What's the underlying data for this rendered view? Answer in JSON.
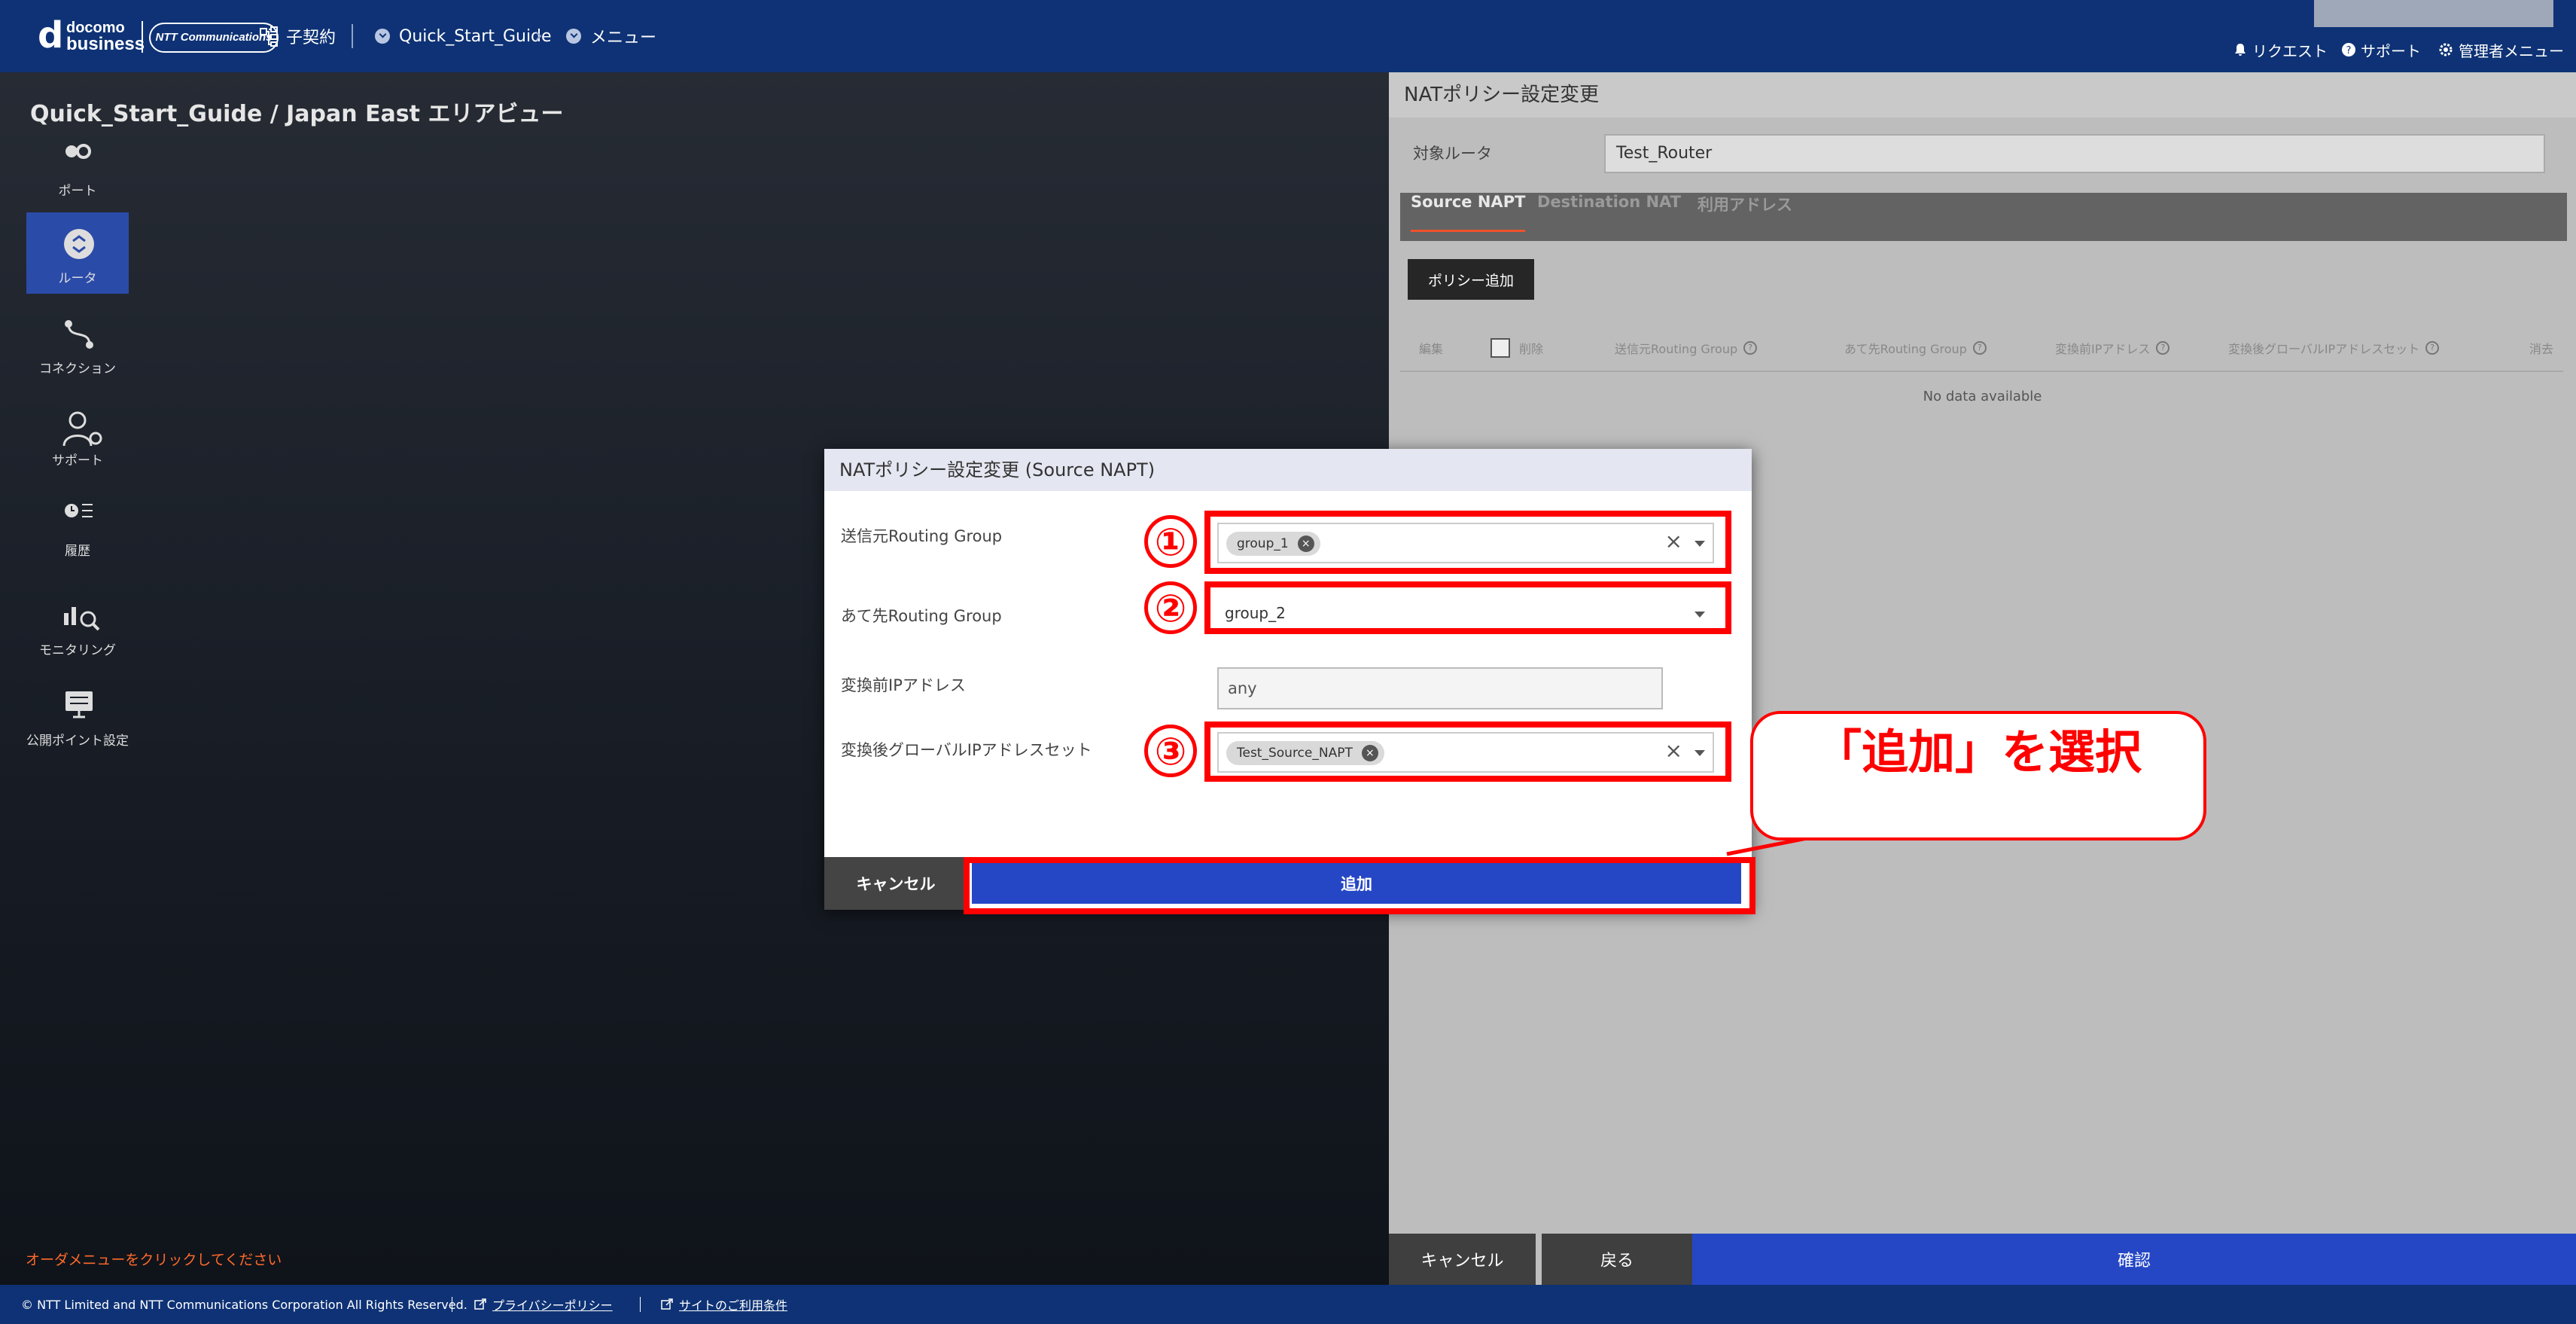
{
  "header": {
    "logo_d": "d",
    "logo_docomo": "docomo",
    "logo_business": "business",
    "logo_ntt": "NTT Communications",
    "contract_label": "子契約",
    "breadcrumb_project": "Quick_Start_Guide",
    "breadcrumb_menu": "メニュー",
    "request_label": "リクエスト",
    "support_label": "サポート",
    "admin_label": "管理者メニュー"
  },
  "map": {
    "title": "Quick_Start_Guide / Japan East エリアビュー",
    "hint": "オーダメニューをクリックしてください"
  },
  "sidebar": {
    "items": [
      {
        "label": "ポート",
        "icon": "port-icon"
      },
      {
        "label": "ルータ",
        "icon": "router-icon"
      },
      {
        "label": "コネクション",
        "icon": "connection-icon"
      },
      {
        "label": "サポート",
        "icon": "support-user-icon"
      },
      {
        "label": "履歴",
        "icon": "history-icon"
      },
      {
        "label": "モニタリング",
        "icon": "monitoring-icon"
      },
      {
        "label": "公開ポイント設定",
        "icon": "display-icon"
      }
    ]
  },
  "panel": {
    "title": "NATポリシー設定変更",
    "target_router_label": "対象ルータ",
    "target_router_value": "Test_Router",
    "tabs": [
      "Source NAPT",
      "Destination NAT",
      "利用アドレス"
    ],
    "active_tab": "Source NAPT",
    "add_policy_button": "ポリシー追加",
    "columns": {
      "edit": "編集",
      "delete": "削除",
      "src_routing_group": "送信元Routing Group",
      "dst_routing_group": "あて先Routing Group",
      "pre_ip": "変換前IPアドレス",
      "post_global_ip_set": "変換後グローバルIPアドレスセット",
      "remove": "消去"
    },
    "no_data": "No data available",
    "cancel_button": "キャンセル",
    "back_button": "戻る",
    "confirm_button": "確認"
  },
  "modal": {
    "title": "NATポリシー設定変更 (Source NAPT)",
    "src_label": "送信元Routing Group",
    "src_chip": "group_1",
    "dst_label": "あて先Routing Group",
    "dst_value": "group_2",
    "pre_ip_label": "変換前IPアドレス",
    "pre_ip_value": "any",
    "post_label": "変換後グローバルIPアドレスセット",
    "post_chip": "Test_Source_NAPT",
    "cancel_button": "キャンセル",
    "add_button": "追加"
  },
  "annotations": {
    "num1": "①",
    "num2": "②",
    "num3": "③",
    "callout": "「追加」を選択",
    "color": "#ff0000"
  },
  "footer": {
    "copyright": "© NTT Limited and NTT Communications Corporation All Rights Reserved.",
    "privacy": "プライバシーポリシー",
    "terms": "サイトのご利用条件"
  },
  "colors": {
    "header_bg": "#0e3275",
    "accent_blue": "#2547c5",
    "sidebar_active": "#2b4ba9",
    "hint_orange": "#ff6a2b"
  }
}
